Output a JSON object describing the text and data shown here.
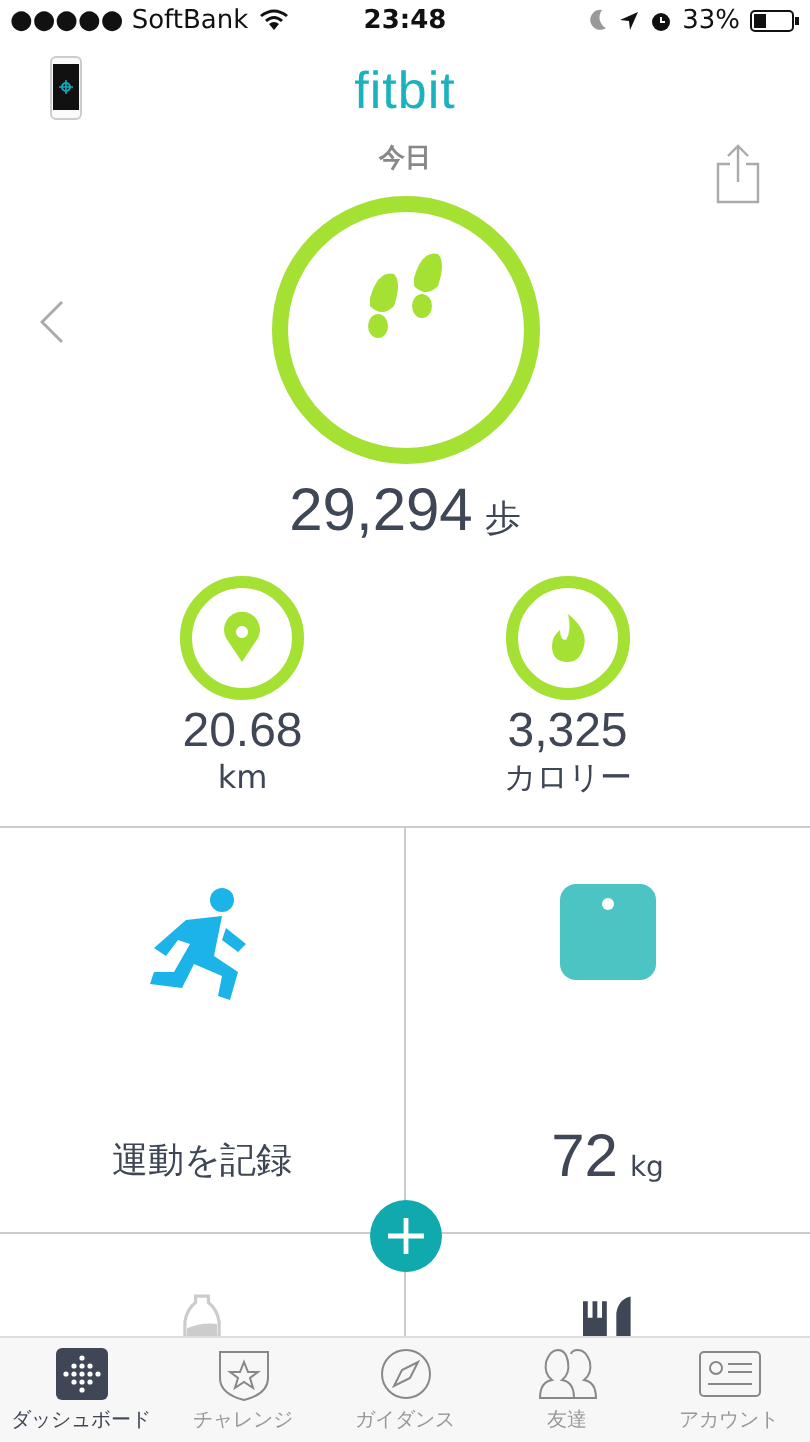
{
  "status_bar": {
    "carrier": "●●●●● SoftBank",
    "time": "23:48",
    "battery": "33%"
  },
  "header": {
    "logo": "fitbit",
    "date": "今日"
  },
  "steps": {
    "value": "29,294",
    "unit": "歩",
    "level": 1
  },
  "stats": [
    {
      "kind": "distance",
      "value": "20.68",
      "unit": "km",
      "level": 1
    },
    {
      "kind": "calories",
      "value": "3,325",
      "unit": "カロリー",
      "level": 1
    }
  ],
  "tiles": [
    {
      "kind": "exercise",
      "label": "運動を記録"
    },
    {
      "kind": "weight",
      "value": "72",
      "unit": "kg"
    },
    {
      "kind": "water"
    },
    {
      "kind": "food"
    }
  ],
  "tabs": [
    {
      "label": "ダッシュボード",
      "kind": "dashboard",
      "selected": true
    },
    {
      "label": "チャレンジ",
      "kind": "challenge",
      "selected": false
    },
    {
      "label": "ガイダンス",
      "kind": "guidance",
      "selected": false
    },
    {
      "label": "友達",
      "kind": "friends",
      "selected": false
    },
    {
      "label": "アカウント",
      "kind": "account",
      "selected": false
    }
  ]
}
